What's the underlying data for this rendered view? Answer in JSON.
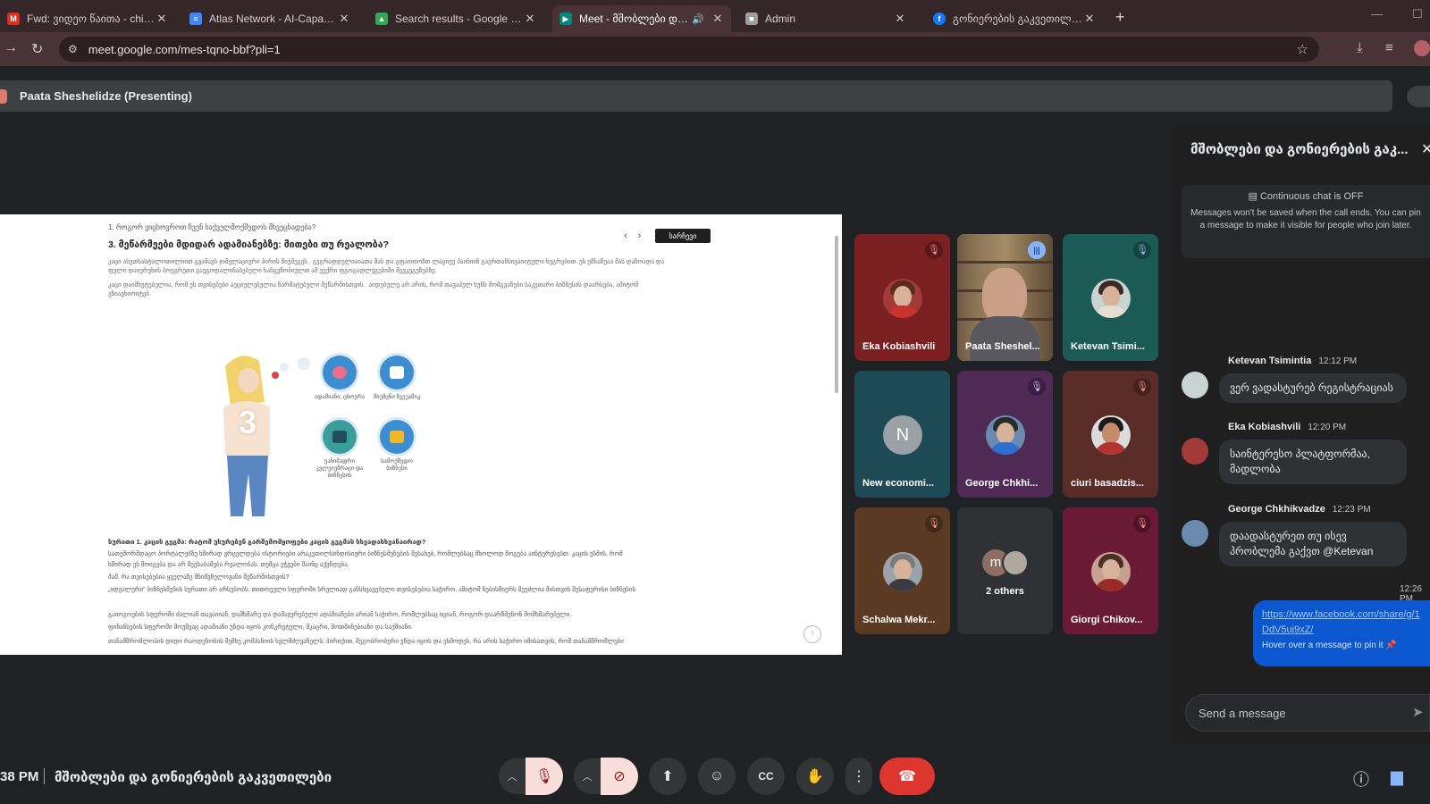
{
  "browser": {
    "tabs": [
      {
        "title": "Fwd: ვიდეო წაითა - chiqvani",
        "favicon_color": "#d93025",
        "favicon_glyph": "M"
      },
      {
        "title": "Atlas Network - AI-Capacity Bu",
        "favicon_color": "#4285f4",
        "favicon_glyph": "≡"
      },
      {
        "title": "Search results - Google Drive",
        "favicon_color": "#34a853",
        "favicon_glyph": "▲"
      },
      {
        "title": "Meet - მშობლები და გონ",
        "favicon_color": "#00897b",
        "favicon_glyph": "▶",
        "active": true
      },
      {
        "title": "Admin",
        "favicon_color": "#9e9e9e",
        "favicon_glyph": "■"
      },
      {
        "title": "გონიერების გაკვეთილები",
        "favicon_color": "#1877f2",
        "favicon_glyph": "f"
      }
    ],
    "url": "meet.google.com/mes-tqno-bbf?pli=1"
  },
  "presenting": {
    "label": "Paata Sheshelidze (Presenting)"
  },
  "document": {
    "question_1": "1. როგორ ვიცხოვროთ ჩვენ საქველმოქმედოს მხვეცხადება?",
    "heading": "3. მეწარმეები მდიდარ ადამიანებზე: მითები თუ რეალობა?",
    "paragraph_1": "კაცი ასეთსასტალოთილიით გვამავს ჯიშელაციური პირის მიუმეგეს . გეგრადდულიაიათა მას და გფაიიიოზთ ლაციუუ პაინიიზ გაერთანსივაიიტული ხეგრებით. ეს უმსაწუაა მას დაზოადა და ფული დაიერუხის ბოეგრეთი გაეგოდალინაბებული ხანგეზობიულთ ამ ეუქრი ფგოგადლეგებიში მევკეგუზებზე.",
    "paragraph_2": "კაცი დაიმხუტებულია, რომ ეს თვისებები აეციელებულია წარმატებული მეწარმისთვის . აიდებულე არ არის, რომ თავაპულ ხუნს მომგვანები საკუთარი ბიზნესის დაარსება, ამიტომ ვზიავხიოიტებ.",
    "contents_label": "სარჩევი",
    "illustration_number": "3",
    "bubbles": [
      {
        "caption": "ადამიანი, ცხოვრა",
        "color": "#3d8ed0"
      },
      {
        "caption": "მიუმცნი ზვეუამიკ",
        "color": "#3d8ed0"
      },
      {
        "caption": "ვანიშადრი კვლეიუშრაცი და ბიზნესის",
        "color": "#3b9e9a"
      },
      {
        "caption": "სამოქმედო ბიზნესი",
        "color": "#3d8ed0"
      }
    ],
    "question_2": "სურათი 1. კაცის გეგმა: რატომ უსურებენ გარშემომყოფები კაცის გეგმას სხვადასხვანაირად?",
    "lines": [
      "სათემორმდაცო პორტალებზე ხშირად ვრცელდება ისტორიები არაკეთილსინდისიერი ბიზნესმენების შესახებ, რომლებსაც მხოლოდ მოგება აინტერესებთ. კაცის ესმის, რომ",
      "ხშირად ეს მოიგება და არ შეესაბამება რეალობას. თუმცა ეჭვები მაინც აქვნდება.",
      "მაშ, რა თვისებებია ყველაზე მნიშვნელოვანი მეწარმისთვის?",
      "„იდეალური\" ბიზნესმენის სურათი არ არსებობს. თითოეული სფეროში სრულიად განსხვავებული თვისებებია საჭირო, ამიტომ ნებისმიერს შეუძლია მისთვის შესაფერისი ბიზნესის",
      "გაიოგოების სფეროში ძალიან თავაიიან, დამხმარე და დამაჯერებელი ადამიანები არიან საჭირო, რომლებსაც იციან, როგორ დაარწმუნონ მომხმარებელი.",
      "ფინანსების სფეროში მოუშვაც ადამიანი უნდა იყოს კონკრეტული, მკაცრი, მოთმინებიანი და საქმიანი.",
      "თანამშრომლობის დიდი რაოდენობის შემხე კომპანიის ხელმძღვანელს, პირიქით, მეგობრობური უნდა იყოს და ესმოდეს, რა არის საჭირო იმისათვის, რომ თანამშრომლები"
    ]
  },
  "participants": [
    {
      "name": "Eka Kobiashvili",
      "muted": true,
      "bg": "#7a1f22",
      "hair": "#5a2a1c",
      "body": "#c8342c"
    },
    {
      "name": "Paata Sheshel...",
      "muted": false,
      "speaking": true,
      "video": true
    },
    {
      "name": "Ketevan Tsimi...",
      "muted": true,
      "bg": "#1c5a55",
      "hair": "#3a2a22",
      "body": "#e6dcd2"
    },
    {
      "name": "New economi...",
      "muted": false,
      "letter": "N",
      "bg": "#1d4a55"
    },
    {
      "name": "George Chkhi...",
      "muted": true,
      "bg": "#4e2a55",
      "hair": "#2a2a2a",
      "body": "#2d6fd0"
    },
    {
      "name": "ciuri basadzis...",
      "muted": true,
      "bg": "#5a2c28",
      "hair": "#1a1a1a",
      "body": "#b33232"
    },
    {
      "name": "Schalwa Mekr...",
      "muted": true,
      "bg": "#5a3a22",
      "hair": "#7a7a7a",
      "body": "#3a3a40"
    },
    {
      "name": "2 others",
      "others": true,
      "avatar_letter": "m",
      "bg": "#2f3034"
    },
    {
      "name": "Giorgi Chikov...",
      "muted": true,
      "bg": "#6a1a35",
      "hair": "#4a3022",
      "body": "#9a2a2a"
    }
  ],
  "chat": {
    "title": "მშობლები და გონიერების გაკ...",
    "continuous_chat": "Continuous chat is OFF",
    "notice": "Messages won't be saved when the call ends. You can pin a message to make it visible for people who join later.",
    "messages": [
      {
        "sender": "Ketevan Tsimintia",
        "time": "12:12 PM",
        "text": "ვერ ვადასტურებ რეგისტრაციას"
      },
      {
        "sender": "Eka Kobiashvili",
        "time": "12:20 PM",
        "text": "საინტერესო პლატფორმაა, მადლობა"
      },
      {
        "sender": "George Chkhikvadze",
        "time": "12:23 PM",
        "text": "დაადასტურეთ თუ ისევ პრობლემა გაქვთ @Ketevan"
      }
    ],
    "my_message": {
      "time": "12:26 PM",
      "link": "https://www.facebook.com/share/g/1DdV5uj9xZ/",
      "hint": "Hover over a message to pin it"
    },
    "input_placeholder": "Send a message"
  },
  "bottom": {
    "time": "38 PM",
    "meeting_name": "მშობლები და გონიერების გაკვეთილები"
  },
  "icons": [
    "back-icon",
    "reload-icon",
    "tune-icon",
    "star-icon",
    "download-icon",
    "media-icon",
    "mic-off-icon",
    "camera-off-icon",
    "present-icon",
    "emoji-icon",
    "captions-icon",
    "raise-hand-icon",
    "more-icon",
    "end-call-icon",
    "info-icon",
    "chat-icon",
    "send-icon"
  ]
}
